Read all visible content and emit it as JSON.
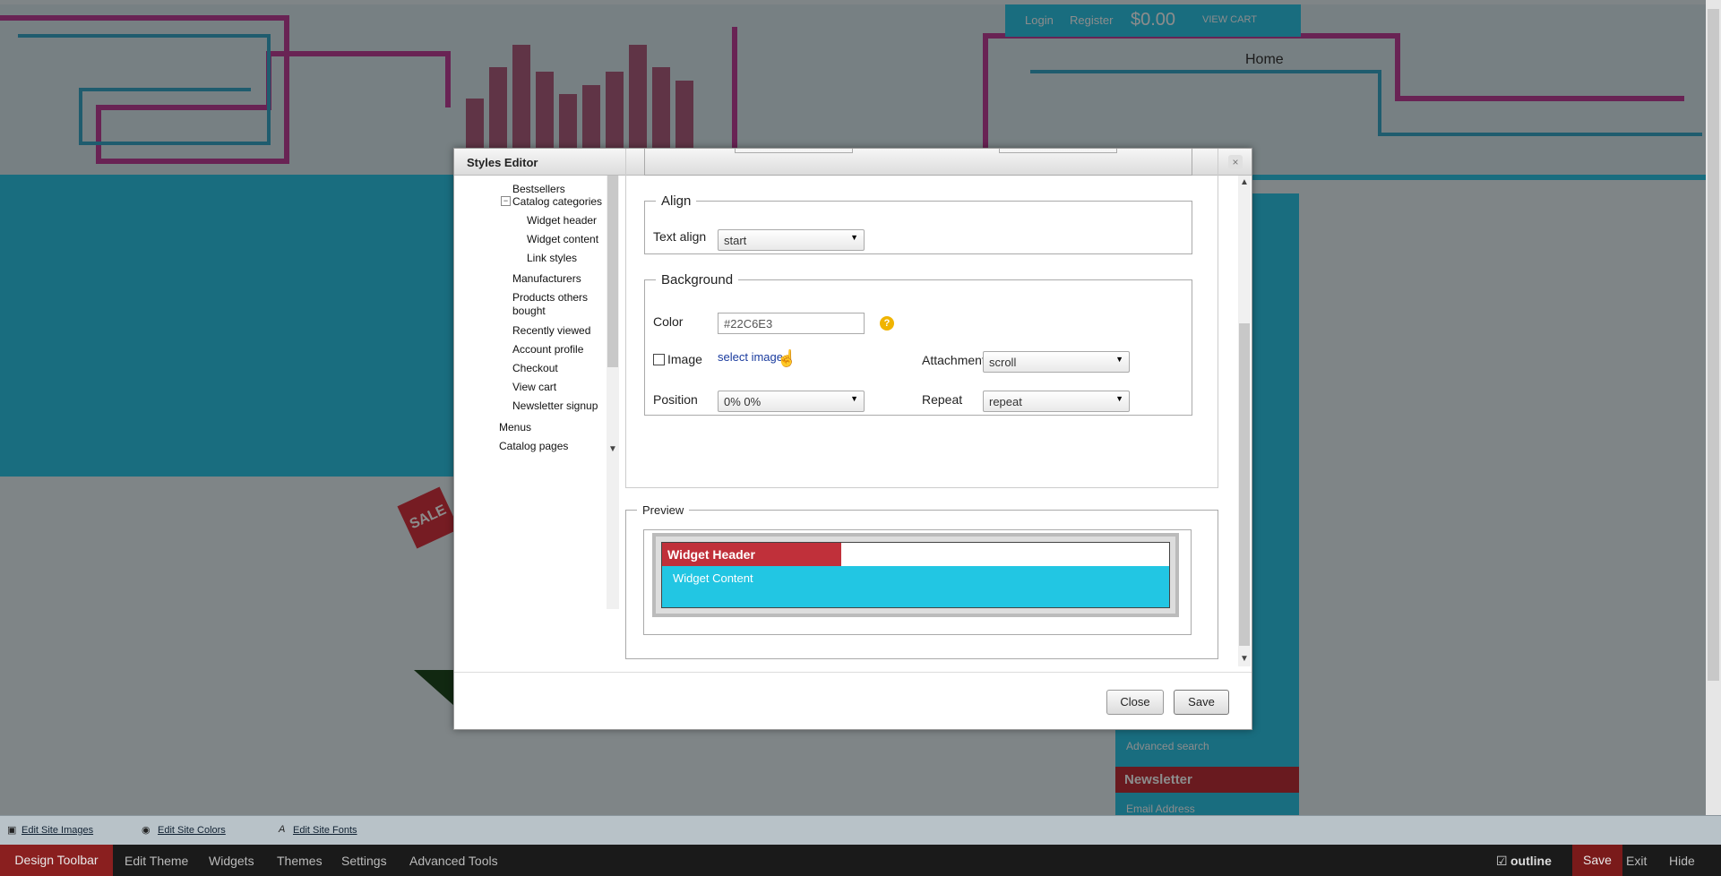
{
  "site": {
    "login": "Login",
    "register": "Register",
    "cart_total": "$0.00",
    "view_cart": "VIEW CART",
    "home": "Home",
    "sale": "SALE",
    "newsletter": "Newsletter",
    "email_placeholder": "Email Address",
    "advanced_search": "Advanced search"
  },
  "dialog": {
    "title": "Styles Editor",
    "close_icon": "×"
  },
  "tree": {
    "items": [
      {
        "label": "Bestsellers"
      },
      {
        "label": "Catalog categories"
      },
      {
        "label": "Widget header"
      },
      {
        "label": "Widget content"
      },
      {
        "label": "Link styles"
      },
      {
        "label": "Manufacturers"
      },
      {
        "label": "Products others bought"
      },
      {
        "label": "Recently viewed"
      },
      {
        "label": "Account profile"
      },
      {
        "label": "Checkout"
      },
      {
        "label": "View cart"
      },
      {
        "label": "Newsletter signup"
      },
      {
        "label": "Menus"
      },
      {
        "label": "Catalog pages"
      }
    ]
  },
  "align": {
    "legend": "Align",
    "text_align_label": "Text align",
    "text_align_value": "start"
  },
  "background": {
    "legend": "Background",
    "color_label": "Color",
    "color_value": "#22C6E3",
    "image_label": "Image",
    "select_image": "select image",
    "attachment_label": "Attachment",
    "attachment_value": "scroll",
    "position_label": "Position",
    "position_value": "0% 0%",
    "repeat_label": "Repeat",
    "repeat_value": "repeat"
  },
  "preview": {
    "legend": "Preview",
    "widget_header": "Widget Header",
    "widget_content": "Widget Content"
  },
  "buttons": {
    "close": "Close",
    "save": "Save"
  },
  "edit_bar": {
    "images": "Edit Site Images",
    "colors": "Edit Site Colors",
    "fonts": "Edit Site Fonts"
  },
  "design_bar": {
    "title": "Design Toolbar",
    "edit_theme": "Edit Theme",
    "widgets": "Widgets",
    "themes": "Themes",
    "settings": "Settings",
    "advanced_tools": "Advanced Tools",
    "outline": "outline",
    "save": "Save",
    "exit": "Exit",
    "hide": "Hide"
  },
  "colors": {
    "accent_red": "#c0303a",
    "cyan": "#22C6E3"
  }
}
